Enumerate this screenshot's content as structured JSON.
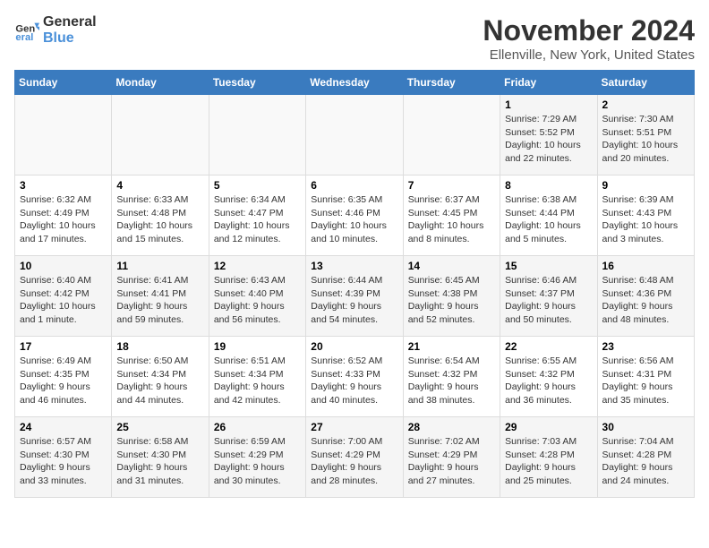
{
  "logo": {
    "line1": "General",
    "line2": "Blue"
  },
  "title": "November 2024",
  "subtitle": "Ellenville, New York, United States",
  "days_of_week": [
    "Sunday",
    "Monday",
    "Tuesday",
    "Wednesday",
    "Thursday",
    "Friday",
    "Saturday"
  ],
  "weeks": [
    [
      {
        "day": "",
        "info": ""
      },
      {
        "day": "",
        "info": ""
      },
      {
        "day": "",
        "info": ""
      },
      {
        "day": "",
        "info": ""
      },
      {
        "day": "",
        "info": ""
      },
      {
        "day": "1",
        "info": "Sunrise: 7:29 AM\nSunset: 5:52 PM\nDaylight: 10 hours and 22 minutes."
      },
      {
        "day": "2",
        "info": "Sunrise: 7:30 AM\nSunset: 5:51 PM\nDaylight: 10 hours and 20 minutes."
      }
    ],
    [
      {
        "day": "3",
        "info": "Sunrise: 6:32 AM\nSunset: 4:49 PM\nDaylight: 10 hours and 17 minutes."
      },
      {
        "day": "4",
        "info": "Sunrise: 6:33 AM\nSunset: 4:48 PM\nDaylight: 10 hours and 15 minutes."
      },
      {
        "day": "5",
        "info": "Sunrise: 6:34 AM\nSunset: 4:47 PM\nDaylight: 10 hours and 12 minutes."
      },
      {
        "day": "6",
        "info": "Sunrise: 6:35 AM\nSunset: 4:46 PM\nDaylight: 10 hours and 10 minutes."
      },
      {
        "day": "7",
        "info": "Sunrise: 6:37 AM\nSunset: 4:45 PM\nDaylight: 10 hours and 8 minutes."
      },
      {
        "day": "8",
        "info": "Sunrise: 6:38 AM\nSunset: 4:44 PM\nDaylight: 10 hours and 5 minutes."
      },
      {
        "day": "9",
        "info": "Sunrise: 6:39 AM\nSunset: 4:43 PM\nDaylight: 10 hours and 3 minutes."
      }
    ],
    [
      {
        "day": "10",
        "info": "Sunrise: 6:40 AM\nSunset: 4:42 PM\nDaylight: 10 hours and 1 minute."
      },
      {
        "day": "11",
        "info": "Sunrise: 6:41 AM\nSunset: 4:41 PM\nDaylight: 9 hours and 59 minutes."
      },
      {
        "day": "12",
        "info": "Sunrise: 6:43 AM\nSunset: 4:40 PM\nDaylight: 9 hours and 56 minutes."
      },
      {
        "day": "13",
        "info": "Sunrise: 6:44 AM\nSunset: 4:39 PM\nDaylight: 9 hours and 54 minutes."
      },
      {
        "day": "14",
        "info": "Sunrise: 6:45 AM\nSunset: 4:38 PM\nDaylight: 9 hours and 52 minutes."
      },
      {
        "day": "15",
        "info": "Sunrise: 6:46 AM\nSunset: 4:37 PM\nDaylight: 9 hours and 50 minutes."
      },
      {
        "day": "16",
        "info": "Sunrise: 6:48 AM\nSunset: 4:36 PM\nDaylight: 9 hours and 48 minutes."
      }
    ],
    [
      {
        "day": "17",
        "info": "Sunrise: 6:49 AM\nSunset: 4:35 PM\nDaylight: 9 hours and 46 minutes."
      },
      {
        "day": "18",
        "info": "Sunrise: 6:50 AM\nSunset: 4:34 PM\nDaylight: 9 hours and 44 minutes."
      },
      {
        "day": "19",
        "info": "Sunrise: 6:51 AM\nSunset: 4:34 PM\nDaylight: 9 hours and 42 minutes."
      },
      {
        "day": "20",
        "info": "Sunrise: 6:52 AM\nSunset: 4:33 PM\nDaylight: 9 hours and 40 minutes."
      },
      {
        "day": "21",
        "info": "Sunrise: 6:54 AM\nSunset: 4:32 PM\nDaylight: 9 hours and 38 minutes."
      },
      {
        "day": "22",
        "info": "Sunrise: 6:55 AM\nSunset: 4:32 PM\nDaylight: 9 hours and 36 minutes."
      },
      {
        "day": "23",
        "info": "Sunrise: 6:56 AM\nSunset: 4:31 PM\nDaylight: 9 hours and 35 minutes."
      }
    ],
    [
      {
        "day": "24",
        "info": "Sunrise: 6:57 AM\nSunset: 4:30 PM\nDaylight: 9 hours and 33 minutes."
      },
      {
        "day": "25",
        "info": "Sunrise: 6:58 AM\nSunset: 4:30 PM\nDaylight: 9 hours and 31 minutes."
      },
      {
        "day": "26",
        "info": "Sunrise: 6:59 AM\nSunset: 4:29 PM\nDaylight: 9 hours and 30 minutes."
      },
      {
        "day": "27",
        "info": "Sunrise: 7:00 AM\nSunset: 4:29 PM\nDaylight: 9 hours and 28 minutes."
      },
      {
        "day": "28",
        "info": "Sunrise: 7:02 AM\nSunset: 4:29 PM\nDaylight: 9 hours and 27 minutes."
      },
      {
        "day": "29",
        "info": "Sunrise: 7:03 AM\nSunset: 4:28 PM\nDaylight: 9 hours and 25 minutes."
      },
      {
        "day": "30",
        "info": "Sunrise: 7:04 AM\nSunset: 4:28 PM\nDaylight: 9 hours and 24 minutes."
      }
    ]
  ]
}
